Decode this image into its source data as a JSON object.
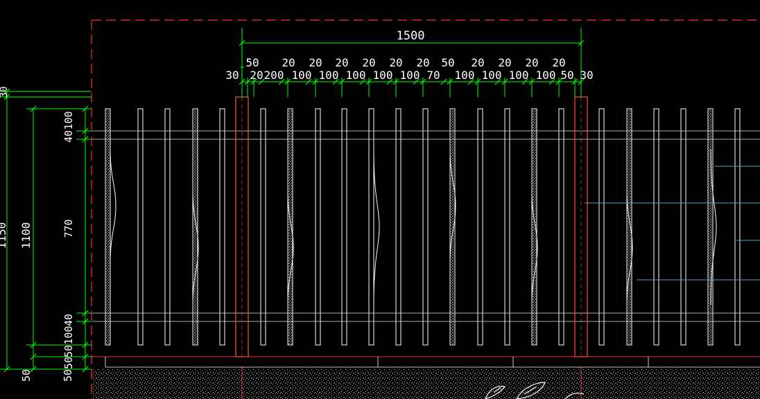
{
  "top_dimensions": {
    "overall": "1500",
    "row1": [
      "50",
      "20",
      "20",
      "20",
      "20",
      "20",
      "20",
      "50",
      "20",
      "20",
      "20",
      "20"
    ],
    "row2": [
      "30",
      "20",
      "200",
      "100",
      "100",
      "100",
      "100",
      "100",
      "70",
      "100",
      "100",
      "100",
      "100",
      "50",
      "30"
    ]
  },
  "left_dimensions": {
    "outer_top_partial": "30",
    "outer_total_partial": "1150",
    "inner_total": "1100",
    "bottom_left_outer": "50",
    "bottom_left_inner": "50",
    "segments": [
      "100",
      "40",
      "770",
      "40",
      "100",
      "50",
      "50"
    ]
  },
  "colors": {
    "background": "#000000",
    "dimension": "#00ff00",
    "dimension_text": "#ffffff",
    "boundary": "#ff3030",
    "post": "#ff5533",
    "picket": "#ffffff",
    "rail": "#e6e6e6",
    "leader": "#4fa6c7",
    "ground_speckle": "#bfbfbf",
    "plant": "#ffffff"
  },
  "icons": [
    "plant-icon"
  ]
}
